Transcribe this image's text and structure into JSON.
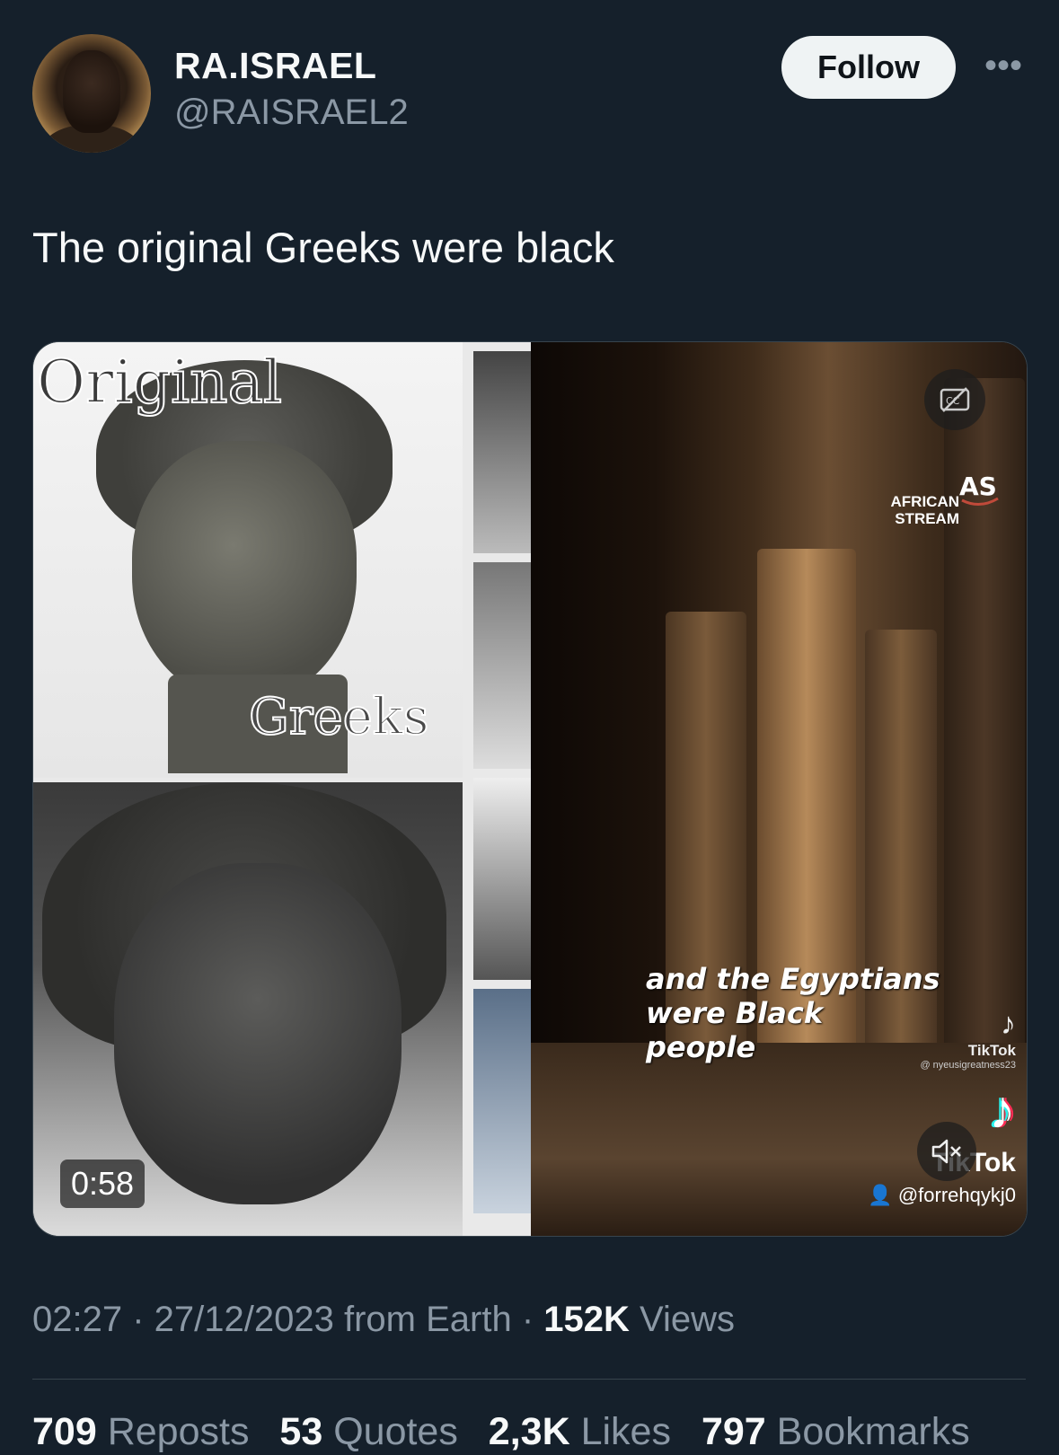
{
  "author": {
    "display_name": "RA.ISRAEL",
    "handle": "@RAISRAEL2"
  },
  "header": {
    "follow_label": "Follow",
    "more_icon": "more-horizontal-icon"
  },
  "tweet": {
    "text": "The original Greeks were black"
  },
  "media": {
    "overlay_original": "Original",
    "overlay_greeks": "Greeks",
    "watermark_line1": "AFRICAN",
    "watermark_line2": "STREAM",
    "caption": "and the Egyptians were Black people",
    "tiktok_label_small": "TikTok",
    "tiktok_handle_small": "@ nyeusigreatness23",
    "tiktok_label_big": "TikTok",
    "tiktok_handle_big": "@forrehqykj0",
    "duration": "0:58",
    "cc_icon": "captions-off-icon",
    "mute_icon": "speaker-muted-icon"
  },
  "meta": {
    "time": "02:27",
    "date": "27/12/2023",
    "source": "from Earth",
    "views_count": "152K",
    "views_label": "Views"
  },
  "stats": {
    "reposts_count": "709",
    "reposts_label": "Reposts",
    "quotes_count": "53",
    "quotes_label": "Quotes",
    "likes_count": "2,3K",
    "likes_label": "Likes",
    "bookmarks_count": "797",
    "bookmarks_label": "Bookmarks"
  }
}
